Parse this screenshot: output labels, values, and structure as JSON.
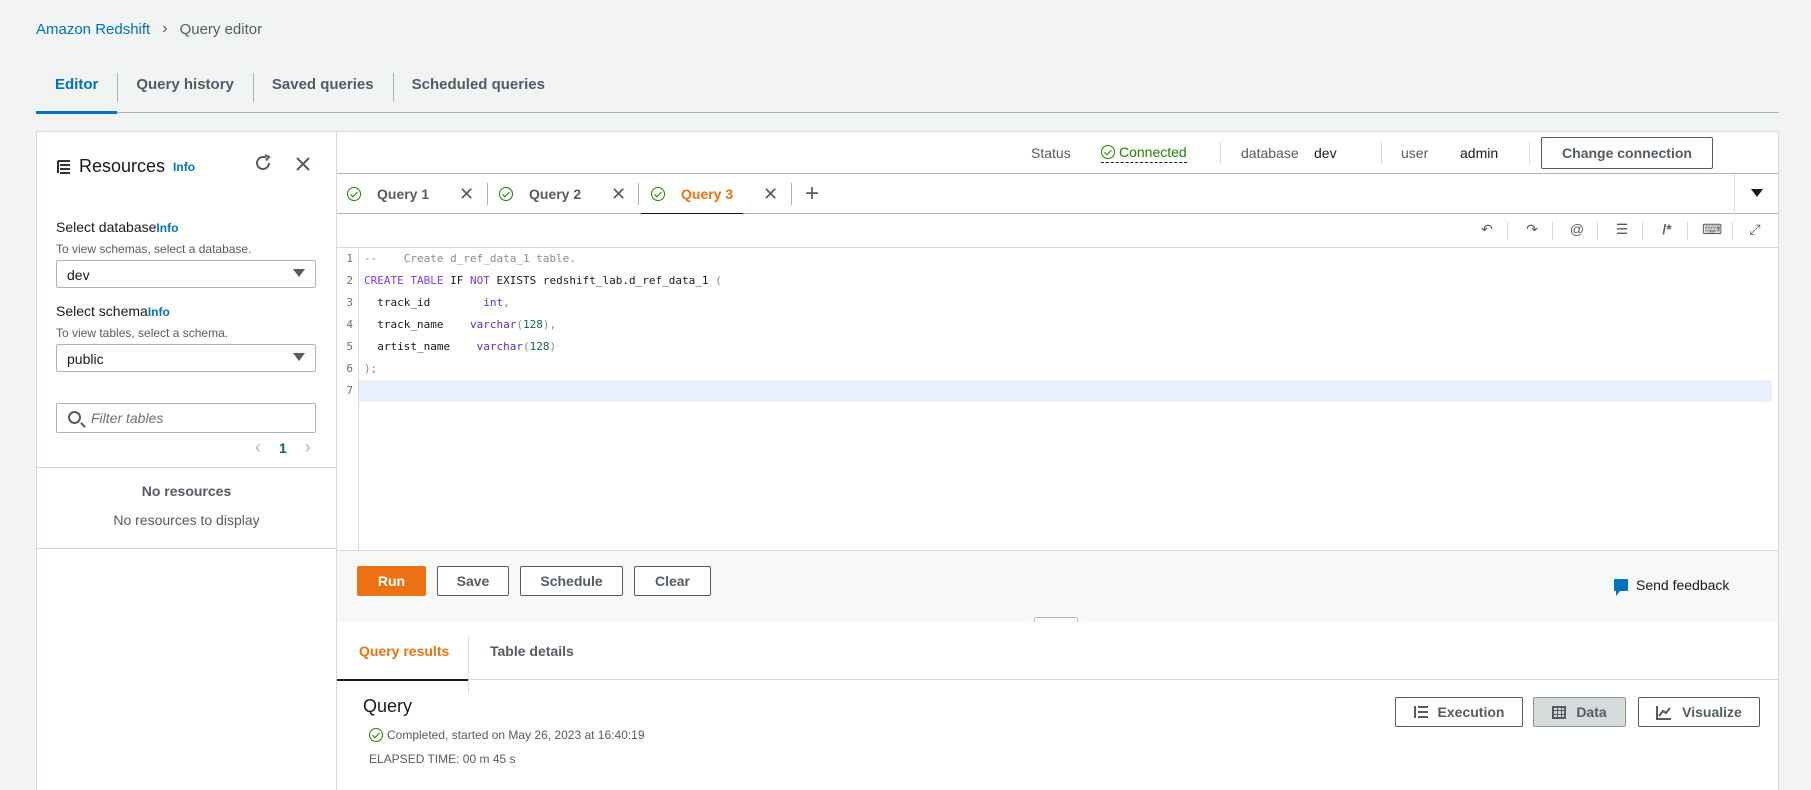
{
  "breadcrumb": {
    "root": "Amazon Redshift",
    "current": "Query editor"
  },
  "top_tabs": [
    "Editor",
    "Query history",
    "Saved queries",
    "Scheduled queries"
  ],
  "resources": {
    "title": "Resources",
    "info": "Info",
    "database_label": "Select database",
    "database_info": "Info",
    "database_desc": "To view schemas, select a database.",
    "database_value": "dev",
    "schema_label": "Select schema",
    "schema_info": "Info",
    "schema_desc": "To view tables, select a schema.",
    "schema_value": "public",
    "filter_placeholder": "Filter tables",
    "page": "1",
    "empty_title": "No resources",
    "empty_desc": "No resources to display"
  },
  "status": {
    "status_label": "Status",
    "status_value": "Connected",
    "database_label": "database",
    "database_value": "dev",
    "user_label": "user",
    "user_value": "admin",
    "change_button": "Change connection"
  },
  "query_tabs": [
    {
      "label": "Query 1",
      "active": false
    },
    {
      "label": "Query 2",
      "active": false
    },
    {
      "label": "Query 3",
      "active": true
    }
  ],
  "toolbar_icons": [
    "undo-icon",
    "redo-icon",
    "at-sign-icon",
    "indent-icon",
    "comment-icon",
    "keyboard-icon",
    "fullscreen-icon"
  ],
  "code": {
    "line_numbers": [
      "1",
      "2",
      "3",
      "4",
      "5",
      "6",
      "7"
    ],
    "l1": "--    Create d_ref_data_1 table.",
    "l2_create": "CREATE",
    "l2_table": "TABLE",
    "l2_if": "IF",
    "l2_not": "NOT",
    "l2_exists": "EXISTS",
    "l2_name": "redshift_lab.d_ref_data_1",
    "l2_paren": "(",
    "l3_col": "track_id",
    "l3_type": "int",
    "l4_col": "track_name",
    "l4_type": "varchar",
    "l4_num": "128",
    "l5_col": "artist_name",
    "l5_type": "varchar",
    "l5_num": "128",
    "l6": ");"
  },
  "actions": {
    "run": "Run",
    "save": "Save",
    "schedule": "Schedule",
    "clear": "Clear",
    "feedback": "Send feedback"
  },
  "results_tabs": [
    "Query results",
    "Table details"
  ],
  "results": {
    "title": "Query",
    "status": "Completed, started on May 26, 2023 at 16:40:19",
    "elapsed": "ELAPSED TIME: 00 m 45 s",
    "execution": "Execution",
    "data": "Data",
    "visualize": "Visualize"
  },
  "colors": {
    "accent": "#ec7211",
    "link": "#0073bb",
    "success": "#1d8102"
  }
}
